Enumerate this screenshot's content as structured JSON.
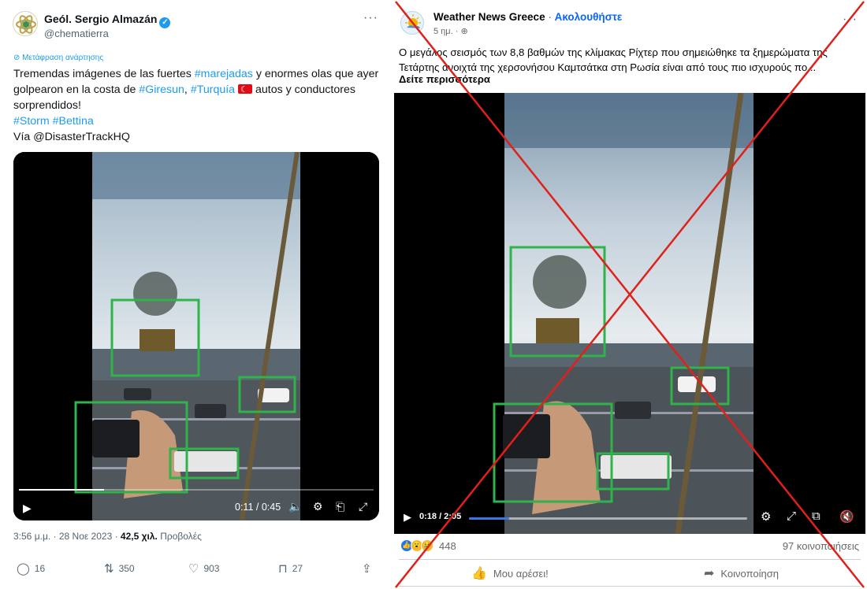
{
  "tweet": {
    "author_name": "Geól. Sergio Almazán",
    "verified_mark": "✓",
    "handle": "@chematierra",
    "more_label": "···",
    "translate_label": "Μετάφραση ανάρτησης",
    "text_lines": {
      "p1_a": "Tremendas imágenes de las fuertes ",
      "p1_tag1": "#marejadas",
      "p1_b": " y enormes olas que ayer golpearon en la costa de ",
      "p1_tag2": "#Giresun",
      "p1_c": ", ",
      "p1_tag3": "#Turquía",
      "p1_d": " autos y conductores sorprendidos!",
      "tags_line": "#Storm #Bettina",
      "via_line": "Vía @DisasterTrackHQ"
    },
    "video": {
      "progress": 0.24,
      "time": "0:11 / 0:45"
    },
    "meta": {
      "timestamp": "3:56 μ.μ. · 28 Νοε 2023 · ",
      "views_count": "42,5 χιλ.",
      "views_label": " Προβολές"
    },
    "actions": {
      "replies": "16",
      "retweets": "350",
      "likes": "903",
      "bookmarks": "27"
    },
    "icons": [
      "avatar-logo",
      "verified-icon",
      "translate-icon",
      "turkey-flag",
      "play-icon",
      "volume-icon",
      "settings-icon",
      "captions-icon",
      "fullscreen-icon",
      "reply-icon",
      "retweet-icon",
      "like-icon",
      "bookmark-icon",
      "share-icon"
    ]
  },
  "facebook": {
    "page_name": "Weather News Greece",
    "separator": " · ",
    "follow_label": "Ακολουθήστε",
    "post_age": "5 ημ. · ",
    "more_label": "···",
    "text": "Ο μεγάλος σεισμός των 8,8 βαθμών της κλίμακας Ρίχτερ που σημειώθηκε τα ξημερώματα της Τετάρτης ανοιχτά της χερσονήσου Καμτσάτκα στη Ρωσία είναι από τους πιο ισχυρούς πο...",
    "see_more": "Δείτε περισσότερα",
    "video": {
      "time": "0:18 / 2:05",
      "progress": 0.144
    },
    "reactions_count": "448",
    "shares": "97 κοινοποιήσεις",
    "like_button": "Μου αρέσει!",
    "share_button": "Κοινοποίηση",
    "icons": [
      "globe-icon",
      "play-icon",
      "settings-icon",
      "fullscreen-icon",
      "pip-icon",
      "mute-icon",
      "like-reaction",
      "wow-reaction",
      "sad-reaction",
      "thumbs-up-icon",
      "share-arrow-icon"
    ]
  },
  "colors": {
    "twitter_blue": "#1d9bf0",
    "facebook_blue": "#0866ff",
    "highlight_box": "#2fb34a",
    "cross_red": "#e0201a"
  }
}
